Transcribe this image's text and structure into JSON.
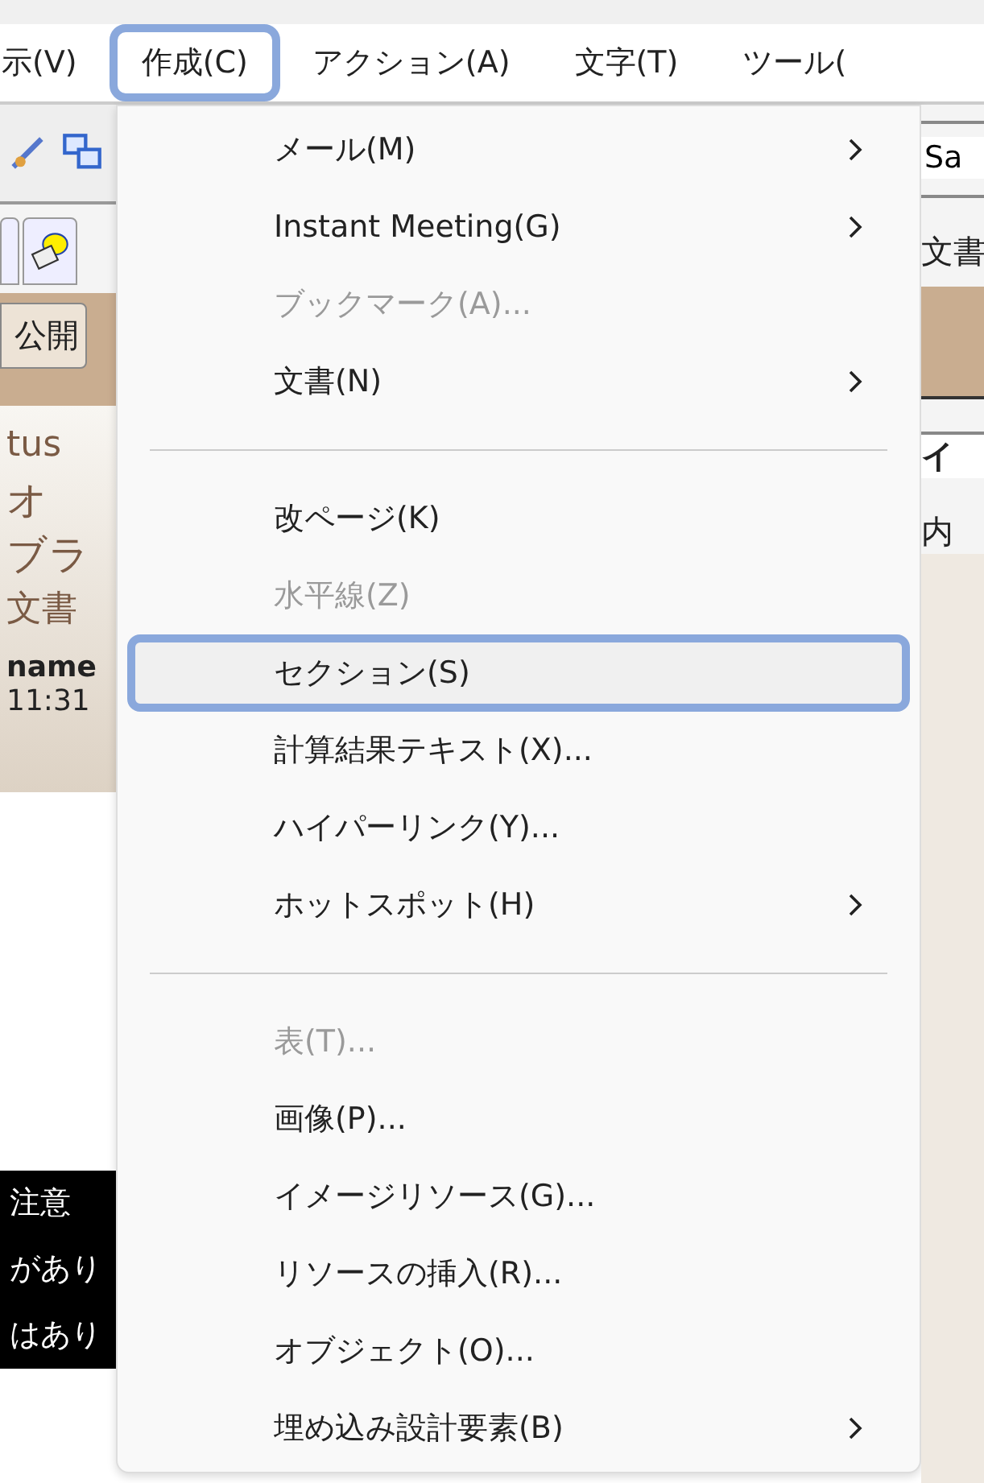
{
  "menu_bar": [
    {
      "label": "示(V)",
      "selected": false
    },
    {
      "label": "作成(C)",
      "selected": true
    },
    {
      "label": "アクション(A)",
      "selected": false
    },
    {
      "label": "文字(T)",
      "selected": false
    },
    {
      "label": "ツール(",
      "selected": false
    }
  ],
  "background_left": {
    "tab_button": "公開",
    "header_lines": [
      "tus",
      "オ",
      "ブラ",
      "文書"
    ],
    "author": "name",
    "time": "11:31",
    "notice_lines": [
      "注意",
      "があり",
      "はあり"
    ]
  },
  "background_right": {
    "font_field": "Sa",
    "texts": [
      "文書",
      "イ",
      "内"
    ]
  },
  "menu": [
    {
      "kind": "item",
      "label": "メール(M)",
      "disabled": false,
      "submenu": true,
      "selected": false
    },
    {
      "kind": "item",
      "label": "Instant Meeting(G)",
      "disabled": false,
      "submenu": true,
      "selected": false
    },
    {
      "kind": "item",
      "label": "ブックマーク(A)...",
      "disabled": true,
      "submenu": false,
      "selected": false
    },
    {
      "kind": "item",
      "label": "文書(N)",
      "disabled": false,
      "submenu": true,
      "selected": false
    },
    {
      "kind": "separator"
    },
    {
      "kind": "item",
      "label": "改ページ(K)",
      "disabled": false,
      "submenu": false,
      "selected": false
    },
    {
      "kind": "item",
      "label": "水平線(Z)",
      "disabled": true,
      "submenu": false,
      "selected": false
    },
    {
      "kind": "item",
      "label": "セクション(S)",
      "disabled": false,
      "submenu": false,
      "selected": true
    },
    {
      "kind": "item",
      "label": "計算結果テキスト(X)...",
      "disabled": false,
      "submenu": false,
      "selected": false
    },
    {
      "kind": "item",
      "label": "ハイパーリンク(Y)...",
      "disabled": false,
      "submenu": false,
      "selected": false
    },
    {
      "kind": "item",
      "label": "ホットスポット(H)",
      "disabled": false,
      "submenu": true,
      "selected": false
    },
    {
      "kind": "separator"
    },
    {
      "kind": "item",
      "label": "表(T)...",
      "disabled": true,
      "submenu": false,
      "selected": false
    },
    {
      "kind": "item",
      "label": "画像(P)...",
      "disabled": false,
      "submenu": false,
      "selected": false
    },
    {
      "kind": "item",
      "label": "イメージリソース(G)...",
      "disabled": false,
      "submenu": false,
      "selected": false
    },
    {
      "kind": "item",
      "label": "リソースの挿入(R)...",
      "disabled": false,
      "submenu": false,
      "selected": false
    },
    {
      "kind": "item",
      "label": "オブジェクト(O)...",
      "disabled": false,
      "submenu": false,
      "selected": false
    },
    {
      "kind": "item",
      "label": "埋め込み設計要素(B)",
      "disabled": false,
      "submenu": true,
      "selected": false
    }
  ]
}
